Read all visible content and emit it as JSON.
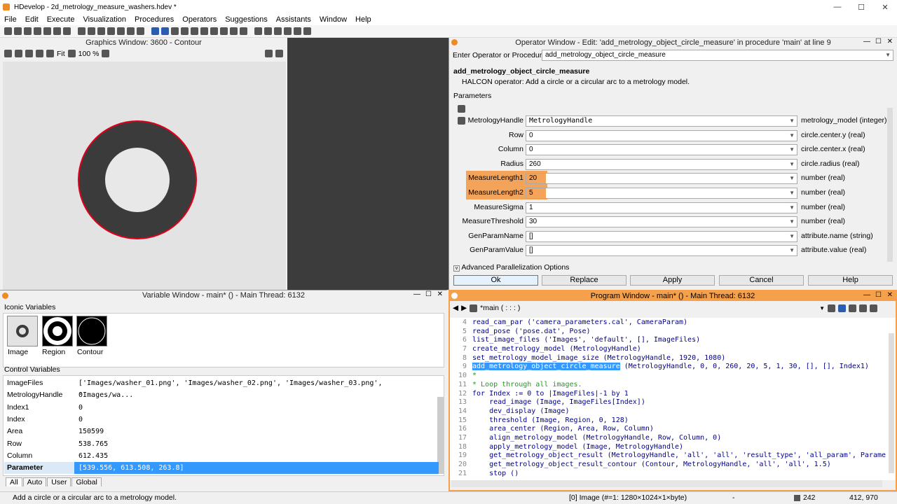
{
  "app": {
    "title": "HDevelop - 2d_metrology_measure_washers.hdev *",
    "controls": [
      "—",
      "☐",
      "✕"
    ]
  },
  "menu": [
    "File",
    "Edit",
    "Execute",
    "Visualization",
    "Procedures",
    "Operators",
    "Suggestions",
    "Assistants",
    "Window",
    "Help"
  ],
  "graphics": {
    "title": "Graphics Window: 3600 - Contour",
    "zoom_mode": "Fit",
    "zoom": "100 %"
  },
  "operator": {
    "window_title": "Operator Window - Edit: 'add_metrology_object_circle_measure' in procedure 'main' at line 9",
    "enter_label": "Enter Operator or Procedure",
    "enter_value": "add_metrology_object_circle_measure",
    "name": "add_metrology_object_circle_measure",
    "description": "HALCON operator:  Add a circle or a circular arc to a metrology model.",
    "params_label": "Parameters",
    "params": [
      {
        "label": "MetrologyHandle",
        "value": "MetrologyHandle",
        "type": "metrology_model (integer)",
        "highlight": false
      },
      {
        "label": "Row",
        "value": "0",
        "type": "circle.center.y (real)",
        "highlight": false
      },
      {
        "label": "Column",
        "value": "0",
        "type": "circle.center.x (real)",
        "highlight": false
      },
      {
        "label": "Radius",
        "value": "260",
        "type": "circle.radius (real)",
        "highlight": false
      },
      {
        "label": "MeasureLength1",
        "value": "20",
        "type": "number (real)",
        "highlight": true
      },
      {
        "label": "MeasureLength2",
        "value": "5",
        "type": "number (real)",
        "highlight": true
      },
      {
        "label": "MeasureSigma",
        "value": "1",
        "type": "number (real)",
        "highlight": false
      },
      {
        "label": "MeasureThreshold",
        "value": "30",
        "type": "number (real)",
        "highlight": false
      },
      {
        "label": "GenParamName",
        "value": "[]",
        "type": "attribute.name (string)",
        "highlight": false
      },
      {
        "label": "GenParamValue",
        "value": "[]",
        "type": "attribute.value (real)",
        "highlight": false
      }
    ],
    "advanced": "Advanced Parallelization Options",
    "buttons": {
      "ok": "Ok",
      "replace": "Replace",
      "apply": "Apply",
      "cancel": "Cancel",
      "help": "Help"
    }
  },
  "variables": {
    "title": "Variable Window - main* () - Main Thread: 6132",
    "iconic_label": "Iconic Variables",
    "iconic": [
      "Image",
      "Region",
      "Contour"
    ],
    "control_label": "Control Variables",
    "control": [
      {
        "name": "ImageFiles",
        "value": "['Images/washer_01.png', 'Images/washer_02.png', 'Images/washer_03.png', 'Images/wa..."
      },
      {
        "name": "MetrologyHandle",
        "value": "0"
      },
      {
        "name": "Index1",
        "value": "0"
      },
      {
        "name": "Index",
        "value": "0"
      },
      {
        "name": "Area",
        "value": "150599"
      },
      {
        "name": "Row",
        "value": "538.765"
      },
      {
        "name": "Column",
        "value": "612.435"
      },
      {
        "name": "Parameter",
        "value": "[539.556, 613.508, 263.8]"
      }
    ],
    "tabs": [
      "All",
      "Auto",
      "User",
      "Global"
    ]
  },
  "program": {
    "title": "Program Window - main* () - Main Thread: 6132",
    "procedure": "*main ( : : : )",
    "lines": [
      {
        "n": "4",
        "text": "read_cam_par ('camera_parameters.cal', CameraParam)",
        "cls": ""
      },
      {
        "n": "5",
        "text": "read_pose ('pose.dat', Pose)",
        "cls": ""
      },
      {
        "n": "6",
        "text": "list_image_files ('Images', 'default', [], ImageFiles)",
        "cls": ""
      },
      {
        "n": "7",
        "text": "create_metrology_model (MetrologyHandle)",
        "cls": ""
      },
      {
        "n": "8",
        "text": "set_metrology_model_image_size (MetrologyHandle, 1920, 1080)",
        "cls": ""
      },
      {
        "n": "9",
        "text": "",
        "cls": "sel9"
      },
      {
        "n": "10",
        "text": "*",
        "cls": "cmt"
      },
      {
        "n": "11",
        "text": "* Loop through all images.",
        "cls": "cmt"
      },
      {
        "n": "12",
        "text": "for Index := 0 to |ImageFiles|-1 by 1",
        "cls": ""
      },
      {
        "n": "13",
        "text": "    read_image (Image, ImageFiles[Index])",
        "cls": ""
      },
      {
        "n": "14",
        "text": "    dev_display (Image)",
        "cls": ""
      },
      {
        "n": "15",
        "text": "    threshold (Image, Region, 0, 128)",
        "cls": ""
      },
      {
        "n": "16",
        "text": "    area_center (Region, Area, Row, Column)",
        "cls": ""
      },
      {
        "n": "17",
        "text": "    align_metrology_model (MetrologyHandle, Row, Column, 0)",
        "cls": ""
      },
      {
        "n": "18",
        "text": "    apply_metrology_model (Image, MetrologyHandle)",
        "cls": ""
      },
      {
        "n": "19",
        "text": "    get_metrology_object_result (MetrologyHandle, 'all', 'all', 'result_type', 'all_param', Parame",
        "cls": ""
      },
      {
        "n": "20",
        "text": "    get_metrology_object_result_contour (Contour, MetrologyHandle, 'all', 'all', 1.5)",
        "cls": ""
      },
      {
        "n": "21",
        "text": "    stop ()",
        "cls": ""
      }
    ],
    "line9_op": "add_metrology_object_circle_measure",
    "line9_args": " (MetrologyHandle, 0, 0, 260, 20, 5, 1, 30, [], [], Index1)"
  },
  "status": {
    "message": "Add a circle or a circular arc to a metrology model.",
    "image_info": "[0] Image (#=1: 1280×1024×1×byte)",
    "dash": "-",
    "gray": "242",
    "coords": "412, 970"
  },
  "colors": {
    "accent": "#3399ff",
    "highlight": "#f3a35a",
    "contour": "#e0001a",
    "program_title": "#f5a04a"
  }
}
